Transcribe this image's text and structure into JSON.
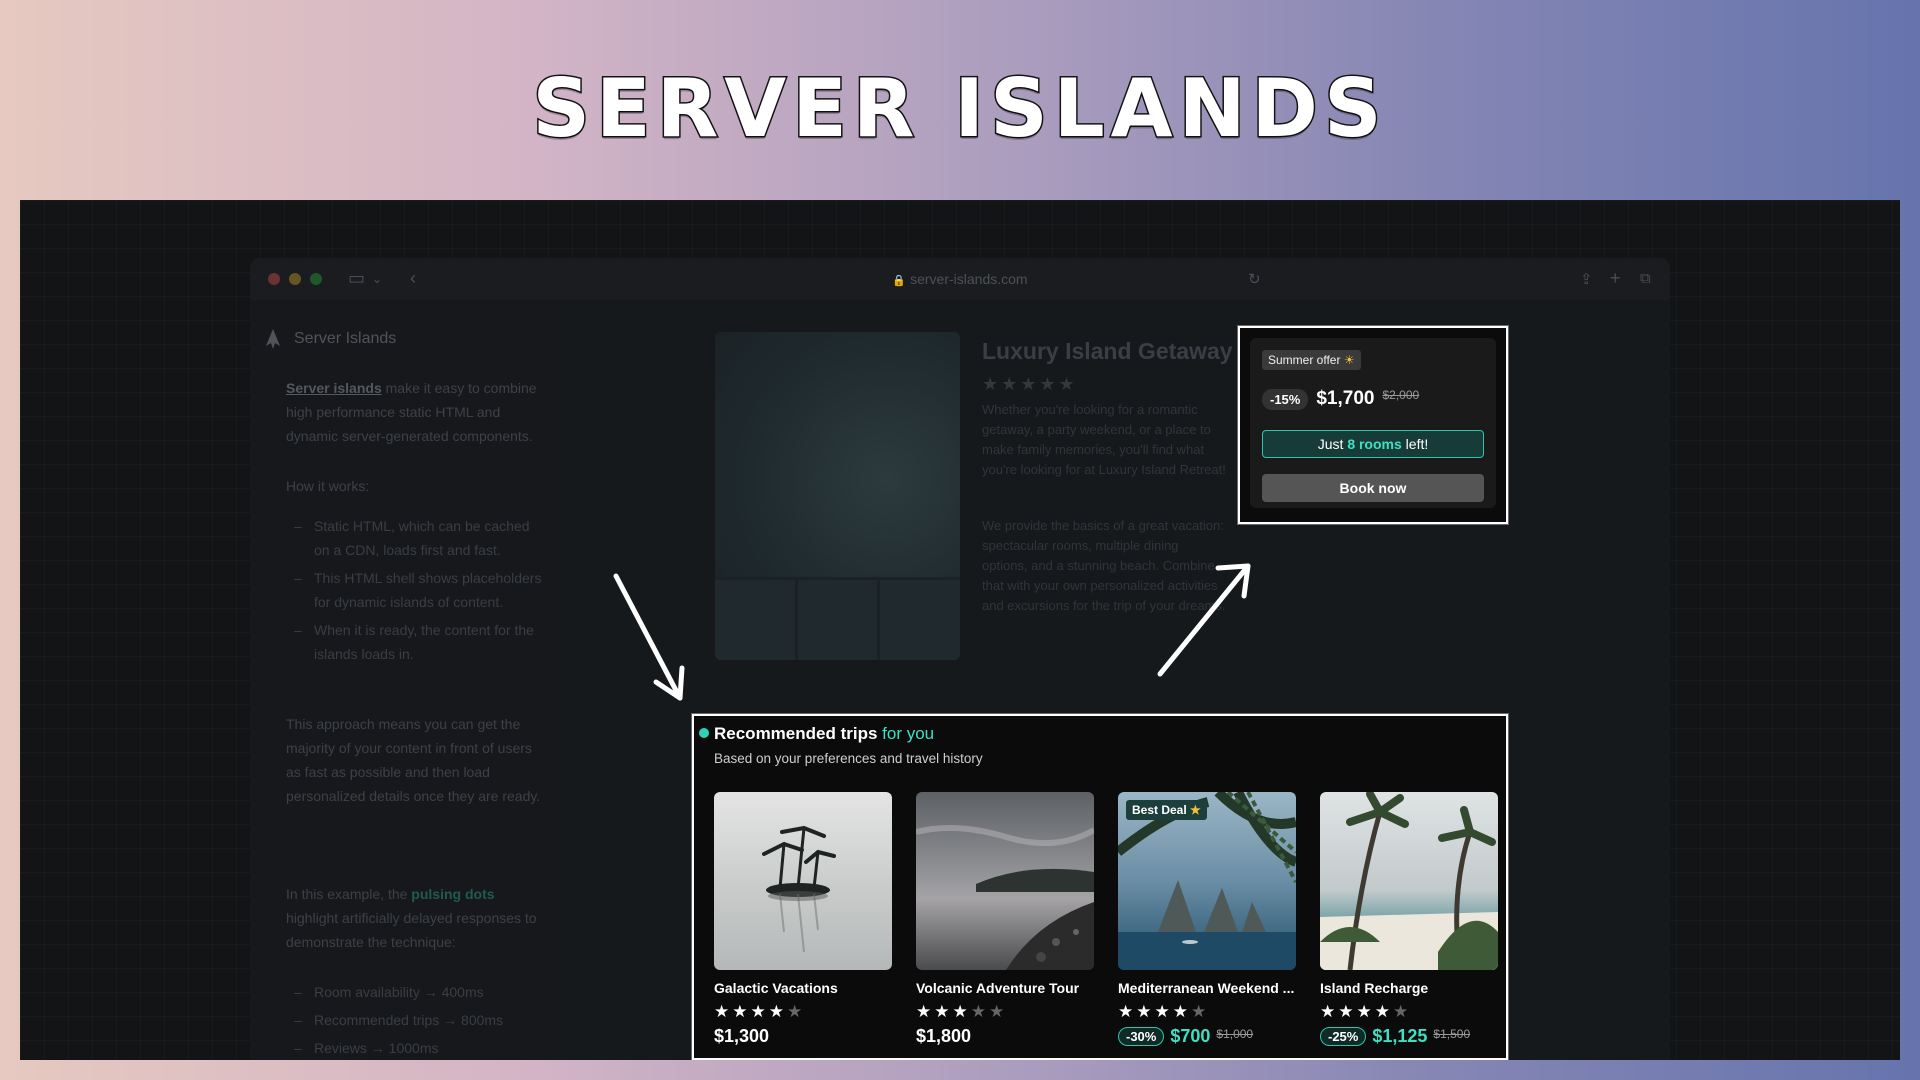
{
  "page_title": "SERVER ISLANDS",
  "browser": {
    "url": "server-islands.com",
    "traffic_light_colors": [
      "#ff5f57",
      "#febc2e",
      "#28c840"
    ]
  },
  "sidebar": {
    "brand": "Server Islands",
    "intro_link": "Server islands",
    "intro_rest": " make it easy to combine high performance static HTML and dynamic server-generated components.",
    "how_label": "How it works:",
    "steps": [
      "Static HTML, which can be cached on a CDN, loads first and fast.",
      "This HTML shell shows placeholders for dynamic islands of content.",
      "When it is ready, the content for the islands loads in."
    ],
    "approach": "This approach means you can get the majority of your content in front of users as fast as possible and then load personalized details once they are ready.",
    "example_prefix": "In this example, the ",
    "example_highlight": "pulsing dots",
    "example_suffix": " highlight artificially delayed responses to demonstrate the technique:",
    "delays": [
      "Room availability → 400ms",
      "Recommended trips → 800ms",
      "Reviews → 1000ms"
    ]
  },
  "product": {
    "title": "Luxury Island Getaway",
    "stars": "★★★★★",
    "desc1": "Whether you're looking for a romantic getaway, a party weekend, or a place to make family memories, you'll find what you're looking for at Luxury Island Retreat!",
    "desc2": "We provide the basics of a great vacation: spectacular rooms, multiple dining options, and a stunning beach. Combine that with your own personalized activities and excursions for the trip of your dreams."
  },
  "offer": {
    "badge": "Summer offer",
    "badge_icon": "☀",
    "discount": "-15%",
    "price": "$1,700",
    "old_price": "$2,000",
    "rooms_prefix": "Just ",
    "rooms_count": "8 rooms",
    "rooms_suffix": " left!",
    "book_label": "Book now"
  },
  "recommended": {
    "heading": "Recommended trips",
    "heading_accent": " for you",
    "subtitle": "Based on your preferences and travel history",
    "star_on": "★★★★",
    "star_off": "★",
    "trips": [
      {
        "title": "Galactic Vacations",
        "rating": 4,
        "price": "$1,300",
        "discount": "",
        "old_price": "",
        "badge": ""
      },
      {
        "title": "Volcanic Adventure Tour",
        "rating": 3,
        "price": "$1,800",
        "discount": "",
        "old_price": "",
        "badge": ""
      },
      {
        "title": "Mediterranean Weekend ...",
        "rating": 4,
        "price": "$700",
        "discount": "-30%",
        "old_price": "$1,000",
        "badge": "Best Deal"
      },
      {
        "title": "Island Recharge",
        "rating": 4,
        "price": "$1,125",
        "discount": "-25%",
        "old_price": "$1,500",
        "badge": ""
      }
    ],
    "best_deal_icon": "★",
    "star_off_three": "★★"
  },
  "colors": {
    "accent": "#3ee0c4",
    "pulse": "#2ed3b7"
  }
}
